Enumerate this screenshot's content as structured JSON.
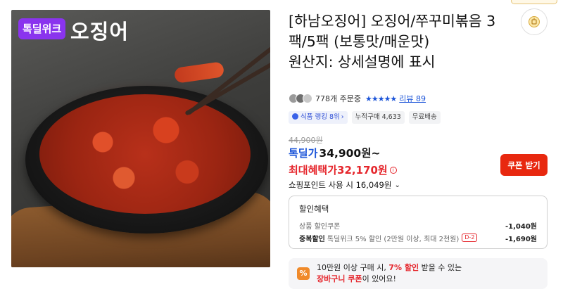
{
  "product_image": {
    "alt": "하남오징어 오징어 쭈꾸미볶음",
    "badge": "톡딜위크",
    "title": "오징어"
  },
  "title": "[하남오징어] 오징어/쭈꾸미볶음 3팩/5팩 (보통맛/매운맛)",
  "origin": "원산지: 상세설명에 표시",
  "share_icon": "coin-share-icon",
  "meta": {
    "orders": "778개 주문중",
    "stars": "★★★★★",
    "review_label": "리뷰 89"
  },
  "chips": {
    "rank": "식품 랭킹 8위",
    "cumulative": "누적구매 4,633",
    "shipping": "무료배송"
  },
  "price": {
    "original": "44,900원",
    "sale_label": "톡딜가",
    "sale_value": "34,900원~",
    "benefit_label": "최대혜택가",
    "benefit_value": "32,170원",
    "info_icon": "i"
  },
  "coupon_button": "쿠폰 받기",
  "points": "쇼핑포인트 사용 시 16,049원",
  "discount": {
    "title": "할인혜택",
    "item1_label": "상품 할인쿠폰",
    "item1_amount": "-1,040원",
    "item2_strong": "중복할인",
    "item2_label": "톡딜위크 5% 할인 (2만원 이상, 최대 2천원)",
    "item2_dday": "D-2",
    "item2_amount": "-1,690원"
  },
  "promo": {
    "icon": "%",
    "line1_a": "10만원 이상 구매 시, ",
    "line1_hl": "7% 할인",
    "line1_b": " 받을 수 있는",
    "line2_hl": "장바구니 쿠폰",
    "line2_b": "이 있어요!"
  },
  "colors": {
    "accent_blue": "#1e56d9",
    "accent_red": "#e5262c",
    "coupon_button": "#e8280f",
    "badge_purple": "#8a34ee",
    "promo_orange": "#f08a2a"
  }
}
